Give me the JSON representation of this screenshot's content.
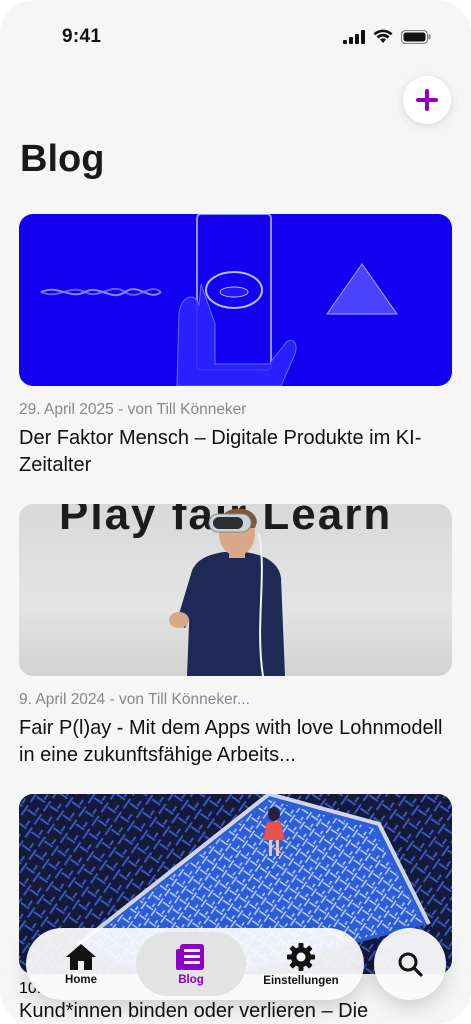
{
  "status_bar": {
    "time": "9:41"
  },
  "header": {
    "title": "Blog"
  },
  "posts": [
    {
      "meta": "29. April 2025 - von Till Könneker",
      "title": "Der Faktor Mensch – Digitale Produkte im KI-Zeitalter"
    },
    {
      "meta": "9. April 2024 - von Till Könneker...",
      "title": "Fair P(l)ay - Mit dem Apps with love Lohnmodell in eine zukunftsfähige Arbeits...",
      "image_text": "Play fair Learn"
    },
    {
      "meta": "10.",
      "title": "Kund*innen binden oder verlieren – Die"
    }
  ],
  "tabbar": {
    "tabs": [
      {
        "label": "Home",
        "icon": "home-icon",
        "active": false
      },
      {
        "label": "Blog",
        "icon": "blog-icon",
        "active": true
      },
      {
        "label": "Einstellungen",
        "icon": "gear-icon",
        "active": false
      }
    ],
    "search_icon": "search-icon"
  },
  "colors": {
    "accent": "#8c00c8",
    "image_blue": "#1200f0"
  }
}
